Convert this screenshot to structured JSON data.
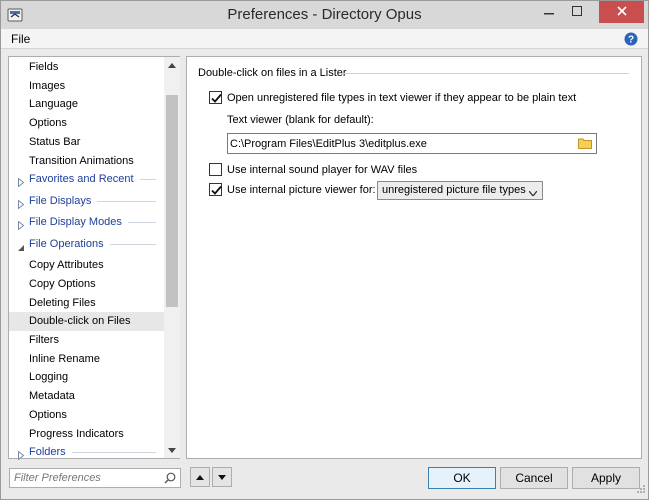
{
  "window": {
    "title": "Preferences - Directory Opus",
    "controls": {
      "minimize": "minimize-icon",
      "maximize": "maximize-icon",
      "close": "close-icon"
    }
  },
  "menu": {
    "file": "File"
  },
  "tree": {
    "items": [
      {
        "label": "Fields",
        "type": "child"
      },
      {
        "label": "Images",
        "type": "child"
      },
      {
        "label": "Language",
        "type": "child"
      },
      {
        "label": "Options",
        "type": "child"
      },
      {
        "label": "Status Bar",
        "type": "child"
      },
      {
        "label": "Transition Animations",
        "type": "child"
      },
      {
        "label": "Favorites and Recent",
        "type": "group",
        "expanded": false
      },
      {
        "label": "File Displays",
        "type": "group",
        "expanded": false
      },
      {
        "label": "File Display Modes",
        "type": "group",
        "expanded": false
      },
      {
        "label": "File Operations",
        "type": "group",
        "expanded": true
      },
      {
        "label": "Copy Attributes",
        "type": "child"
      },
      {
        "label": "Copy Options",
        "type": "child"
      },
      {
        "label": "Deleting Files",
        "type": "child"
      },
      {
        "label": "Double-click on Files",
        "type": "child",
        "selected": true
      },
      {
        "label": "Filters",
        "type": "child"
      },
      {
        "label": "Inline Rename",
        "type": "child"
      },
      {
        "label": "Logging",
        "type": "child"
      },
      {
        "label": "Metadata",
        "type": "child"
      },
      {
        "label": "Options",
        "type": "child"
      },
      {
        "label": "Progress Indicators",
        "type": "child"
      },
      {
        "label": "Folders",
        "type": "group",
        "expanded": false
      }
    ]
  },
  "panel": {
    "section_title": "Double-click on files in a Lister",
    "open_unregistered": {
      "label": "Open unregistered file types in text viewer if they appear to be plain text",
      "checked": true
    },
    "text_viewer_label": "Text viewer (blank for default):",
    "text_viewer_value": "C:\\Program Files\\EditPlus 3\\editplus.exe",
    "sound_player": {
      "label": "Use internal sound player for WAV files",
      "checked": false
    },
    "picture_viewer": {
      "label": "Use internal picture viewer for:",
      "checked": true
    },
    "picture_viewer_option": "unregistered picture file types"
  },
  "footer": {
    "filter_placeholder": "Filter Preferences",
    "ok": "OK",
    "cancel": "Cancel",
    "apply": "Apply"
  },
  "colors": {
    "group_text": "#1e3f9a",
    "close_button": "#c94e4e",
    "default_button_border": "#3c7fb1"
  }
}
